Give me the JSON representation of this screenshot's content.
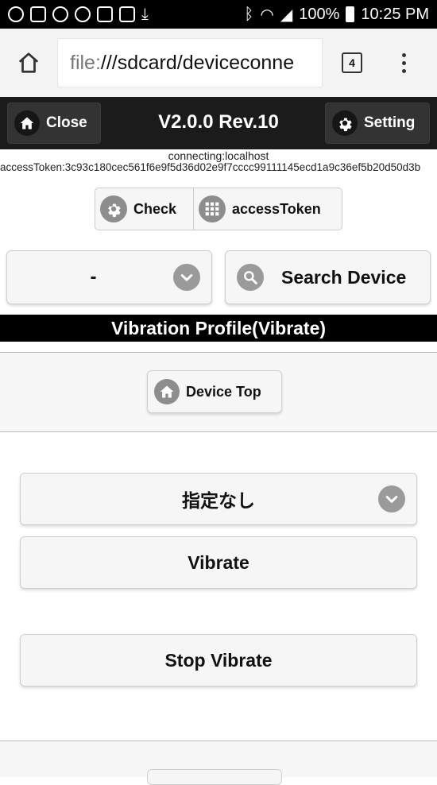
{
  "status": {
    "battery": "100%",
    "time": "10:25 PM"
  },
  "browser": {
    "url_scheme": "file:",
    "url_rest": "///sdcard/deviceconne",
    "tab_count": "4"
  },
  "header": {
    "close_label": "Close",
    "title": "V2.0.0 Rev.10",
    "setting_label": "Setting"
  },
  "connection": {
    "status": "connecting:localhost",
    "access_token": "accessToken:3c93c180cec561f6e9f5d36d02e9f7cccc99111145ecd1a9c36ef5b20d50d3b"
  },
  "toolbar": {
    "check_label": "Check",
    "access_token_label": "accessToken"
  },
  "device": {
    "selected": "-",
    "search_label": "Search Device"
  },
  "profile": {
    "title": "Vibration Profile(Vibrate)"
  },
  "nav": {
    "device_top_label": "Device Top"
  },
  "vibrate": {
    "pattern_selected": "指定なし",
    "vibrate_label": "Vibrate",
    "stop_label": "Stop Vibrate"
  }
}
